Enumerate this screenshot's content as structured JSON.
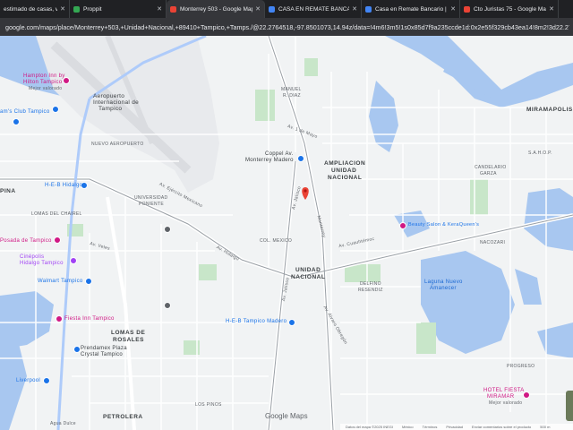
{
  "tabs": [
    {
      "title": "estimado de casas, ven",
      "active": false,
      "color": "#9aa0a6"
    },
    {
      "title": "Proppit",
      "active": false,
      "color": "#34a853"
    },
    {
      "title": "Monterrey 503 - Google Maps",
      "active": true,
      "color": "#ea4335"
    },
    {
      "title": "CASA EN REMATE BANCARIO",
      "active": false,
      "color": "#4285f4"
    },
    {
      "title": "Casa en Remate Bancario | Lo",
      "active": false,
      "color": "#4285f4"
    },
    {
      "title": "Cto Juristas 75 - Google Maps",
      "active": false,
      "color": "#ea4335"
    }
  ],
  "url": "google.com/maps/place/Monterrey+503,+Unidad+Nacional,+89410+Tampico,+Tamps./@22.2764518,-97.8501073,14.94z/data=!4m6!3m5!1s0x85d7f9a235ccde1d:0x2e55f329cb43ea14!8m2!3d22.27976",
  "map": {
    "labels": {
      "hampton": "Hampton Inn by",
      "hampton2": "Hilton Tampico",
      "hampton3": "Mejor valorado",
      "airport1": "Aeropuerto",
      "airport2": "Internacional de",
      "airport3": "Tampico",
      "club": "am's Club Tampico",
      "heb_hidalgo": "H-E-B Hidalgo",
      "nuevo_aeropuerto": "NUEVO AEROPUERTO",
      "universidad": "UNIVERSIDAD",
      "poniente": "PONIENTE",
      "chairel": "LOMAS DEL CHAIREL",
      "espina": "PINA",
      "posada": "Posada de Tampico",
      "cinepolis1": "Cinépolis",
      "cinepolis2": "Hidalgo Tampico",
      "walmart": "Walmart Tampico",
      "fiesta_inn": "Fiesta Inn Tampico",
      "lomas_rosales1": "LOMAS DE",
      "lomas_rosales2": "ROSALES",
      "liverpool": "Liverpool",
      "prendamex1": "Prendamex Plaza",
      "prendamex2": "Crystal Tampico",
      "petrolera": "PETROLERA",
      "agua_dulce": "Agua Dulce",
      "los_pinos": "LOS PINOS",
      "manuel": "MANUEL",
      "avila": "R. DIAZ",
      "coppel1": "Coppel Av.",
      "coppel2": "Monterrey Madero",
      "ampliacion1": "AMPLIACION",
      "ampliacion2": "UNIDAD",
      "ampliacion3": "NACIONAL",
      "col_mexico": "COL. MEXICO",
      "unidad1": "UNIDAD",
      "unidad2": "NACIONAL",
      "heb_madero": "H-E-B Tampico Madero",
      "delfino1": "DELFINO",
      "delfino2": "RESENDIZ",
      "laguna1": "Laguna Nuevo",
      "laguna2": "Amanecer",
      "miramapolis": "MIRAMAPOLIS",
      "candelario1": "CANDELARIO",
      "candelario2": "GARZA",
      "nacozari": "NACOZARI",
      "sahop": "S.A.H.O.P.",
      "progreso": "PROGRESO",
      "hotel_fiesta1": "HOTEL FIESTA",
      "hotel_fiesta2": "MIRAMAR",
      "hotel_fiesta3": "Mejor valorado",
      "keraqueens": "Beauty Salon & KeraQueen's",
      "av_cuauhtemoc": "Av. Cuauhtémoc",
      "av_jalisco": "Av. Jalisco",
      "av_jalisco2": "Av. Jalisco",
      "monterrey": "Monterrey",
      "av_mayo": "Av. 1 de Mayo",
      "av_velez": "Av. Veles",
      "av_hidalgo": "Av. Hidalgo",
      "av_gomez": "Av. Álvaro Obregón",
      "av_ejercito": "Av. Ejército Mexicano"
    },
    "logo": "Google Maps",
    "footer": [
      "Datos del mapa ©2025 INEGI",
      "México",
      "Términos",
      "Privacidad",
      "Enviar comentarios sobre el producto",
      "500 m"
    ]
  }
}
